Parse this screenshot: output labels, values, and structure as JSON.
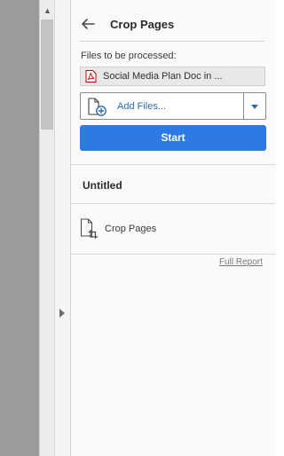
{
  "panel": {
    "title": "Crop Pages",
    "back_icon": "arrow-left-icon"
  },
  "files": {
    "label": "Files to be processed:",
    "selected_file": "Social Media Plan Doc in ...",
    "file_icon": "pdf-file-icon"
  },
  "add_files": {
    "label": "Add Files...",
    "icon": "add-file-icon",
    "dropdown_icon": "chevron-down-icon"
  },
  "start": {
    "label": "Start"
  },
  "section": {
    "title": "Untitled"
  },
  "actions": [
    {
      "label": "Crop Pages",
      "icon": "crop-pages-icon"
    }
  ],
  "report": {
    "label": "Full Report"
  },
  "colors": {
    "accent": "#2d7ae4",
    "link": "#2b6ab8",
    "document_gray": "#9b9b9b"
  }
}
